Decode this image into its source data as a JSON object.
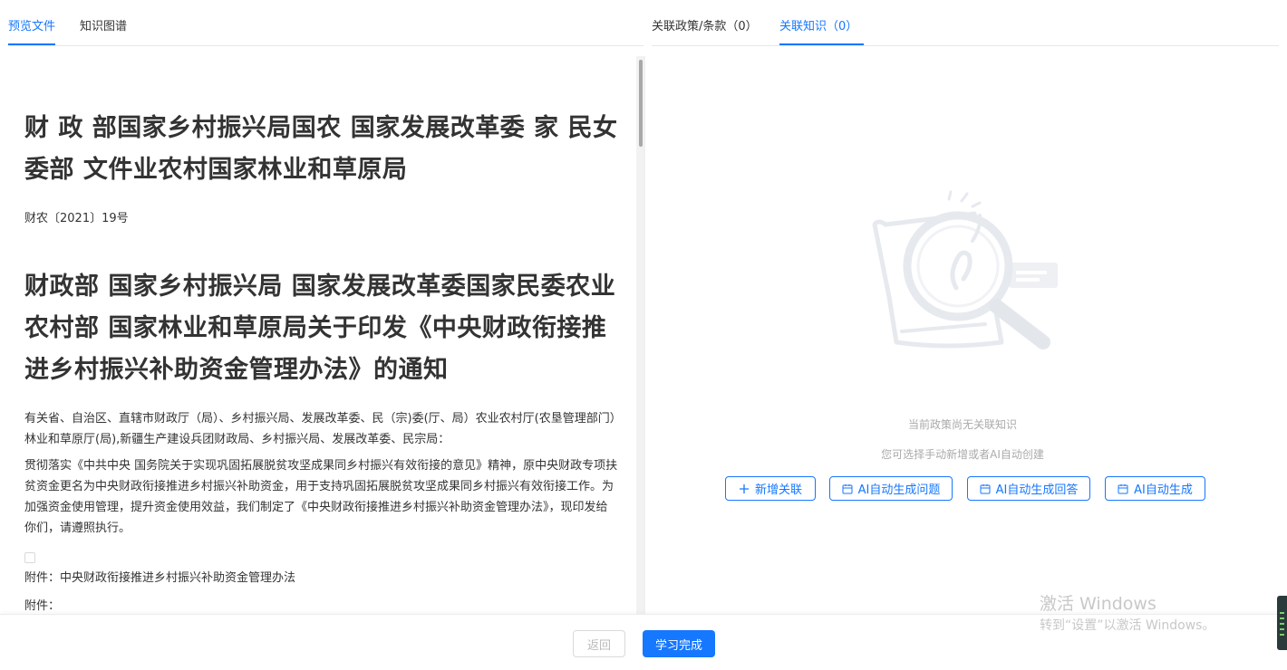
{
  "left_tabs": [
    {
      "label": "预览文件",
      "active": true
    },
    {
      "label": "知识图谱",
      "active": false
    }
  ],
  "right_tabs": [
    {
      "label": "关联政策/条款（0）",
      "active": false
    },
    {
      "label": "关联知识（0）",
      "active": true
    }
  ],
  "document": {
    "title1": "财 政 部国家乡村振兴局国农 国家发展改革委 家 民女委部 文件业农村国家林业和草原局",
    "doc_number": "财农〔2021〕19号",
    "title2": "财政部 国家乡村振兴局 国家发展改革委国家民委农业农村部 国家林业和草原局关于印发《中央财政衔接推进乡村振兴补助资金管理办法》的通知",
    "para1": "有关省、自治区、直辖市财政厅（局）、乡村振兴局、发展改革委、民（宗)委(厅、局）农业农村厅(农垦管理部门）林业和草原厅(局),新疆生产建设兵团财政局、乡村振兴局、发展改革委、民宗局：",
    "para2": "贯彻落实《中共中央 国务院关于实现巩固拓展脱贫攻坚成果同乡村振兴有效衔接的意见》精神，原中央财政专项扶贫资金更名为中央财政衔接推进乡村振兴补助资金，用于支持巩固拓展脱贫攻坚成果同乡村振兴有效衔接工作。为加强资金使用管理，提升资金使用效益，我们制定了《中央财政衔接推进乡村振兴补助资金管理办法》，现印发给你们，请遵照执行。",
    "attachment1": "附件：中央财政衔接推进乡村振兴补助资金管理办法",
    "attachment2": "附件："
  },
  "empty_state": {
    "title": "当前政策尚无关联知识",
    "subtitle": "您可选择手动新增或者AI自动创建",
    "illustration_icon": "magnifier-document-illustration"
  },
  "actions": {
    "add": "新增关联",
    "ai_question": "AI自动生成问题",
    "ai_answer": "AI自动生成回答",
    "ai_generate": "AI自动生成"
  },
  "footer": {
    "back": "返回",
    "done": "学习完成"
  },
  "watermark": {
    "line1": "激活 Windows",
    "line2": "转到“设置”以激活 Windows。"
  },
  "colors": {
    "accent": "#1677ff",
    "muted": "#aaaaaa"
  }
}
